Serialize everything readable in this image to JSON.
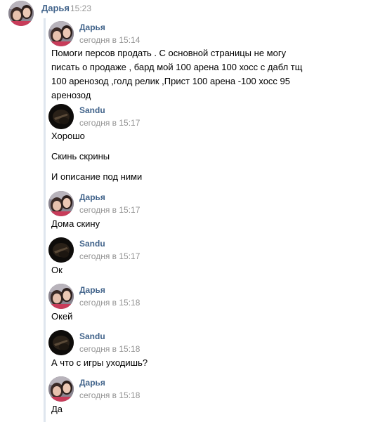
{
  "header": {
    "name": "Дарья",
    "time": "15:23"
  },
  "messages": [
    {
      "author": "Дарья",
      "date": "сегодня в 15:14",
      "avatar": "darya-avatar",
      "lines": [
        "Помоги персов продать . С основной страницы не могу",
        "писать о продаже , бард мой 100 арена 100 хосс с дабл тщ",
        "100 аренозод ,голд релик ,Прист 100 арена -100 хосс 95",
        "аренозод"
      ]
    },
    {
      "author": "Sandu",
      "date": "сегодня в 15:17",
      "avatar": "sandu-avatar",
      "lines": [
        "Хорошо",
        "Скинь скрины",
        "И описание под ними"
      ]
    },
    {
      "author": "Дарья",
      "date": "сегодня в 15:17",
      "avatar": "darya-avatar",
      "lines": [
        "Дома скину"
      ]
    },
    {
      "author": "Sandu",
      "date": "сегодня в 15:17",
      "avatar": "sandu-avatar",
      "lines": [
        "Ок"
      ]
    },
    {
      "author": "Дарья",
      "date": "сегодня в 15:18",
      "avatar": "darya-avatar",
      "lines": [
        "Окей"
      ]
    },
    {
      "author": "Sandu",
      "date": "сегодня в 15:18",
      "avatar": "sandu-avatar",
      "lines": [
        "А что с игры уходишь?"
      ]
    },
    {
      "author": "Дарья",
      "date": "сегодня в 15:18",
      "avatar": "darya-avatar",
      "lines": [
        "Да"
      ]
    }
  ]
}
